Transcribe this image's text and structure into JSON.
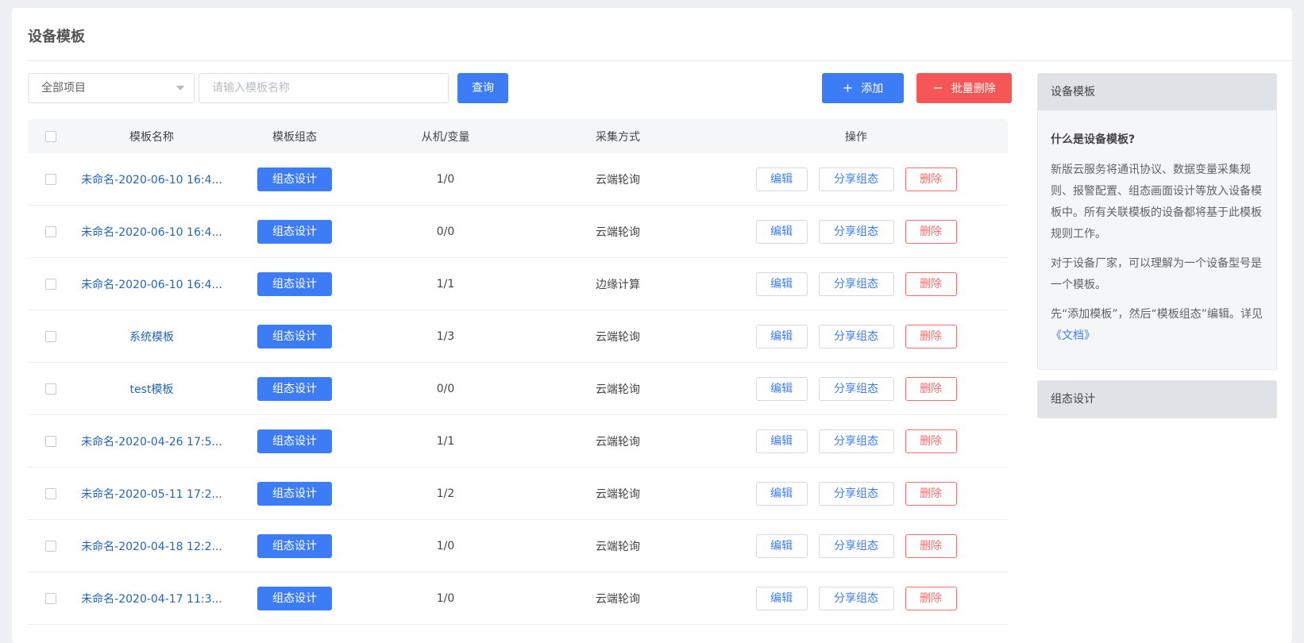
{
  "page": {
    "title": "设备模板"
  },
  "toolbar": {
    "project_select": "全部项目",
    "search_placeholder": "请输入模板名称",
    "query_label": "查询",
    "add_icon": "+",
    "add_label": "添加",
    "batch_delete_icon": "−",
    "batch_delete_label": "批量删除"
  },
  "table": {
    "headers": {
      "name": "模板名称",
      "design": "模板组态",
      "count": "从机/变量",
      "mode": "采集方式",
      "ops": "操作"
    },
    "design_label": "组态设计",
    "edit_label": "编辑",
    "share_label": "分享组态",
    "delete_label": "删除",
    "rows": [
      {
        "name": "未命名-2020-06-10 16:4...",
        "count": "1/0",
        "mode": "云端轮询"
      },
      {
        "name": "未命名-2020-06-10 16:4...",
        "count": "0/0",
        "mode": "云端轮询"
      },
      {
        "name": "未命名-2020-06-10 16:4...",
        "count": "1/1",
        "mode": "边缘计算"
      },
      {
        "name": "系统模板",
        "count": "1/3",
        "mode": "云端轮询"
      },
      {
        "name": "test模板",
        "count": "0/0",
        "mode": "云端轮询"
      },
      {
        "name": "未命名-2020-04-26 17:5...",
        "count": "1/1",
        "mode": "云端轮询"
      },
      {
        "name": "未命名-2020-05-11 17:2...",
        "count": "1/2",
        "mode": "云端轮询"
      },
      {
        "name": "未命名-2020-04-18 12:2...",
        "count": "1/0",
        "mode": "云端轮询"
      },
      {
        "name": "未命名-2020-04-17 11:3...",
        "count": "1/0",
        "mode": "云端轮询"
      }
    ]
  },
  "help": {
    "title": "设备模板",
    "question": "什么是设备模板?",
    "p1": "新版云服务将通讯协议、数据变量采集规则、报警配置、组态画面设计等放入设备模板中。所有关联模板的设备都将基于此模板规则工作。",
    "p2": "对于设备厂家，可以理解为一个设备型号是一个模板。",
    "p3": "先“添加模板”，然后“模板组态”编辑。详见",
    "doc_link": "《文档》",
    "section2_title": "组态设计"
  },
  "colors": {
    "primary": "#3c7cf6",
    "danger": "#f65656",
    "link": "#2365b8"
  }
}
